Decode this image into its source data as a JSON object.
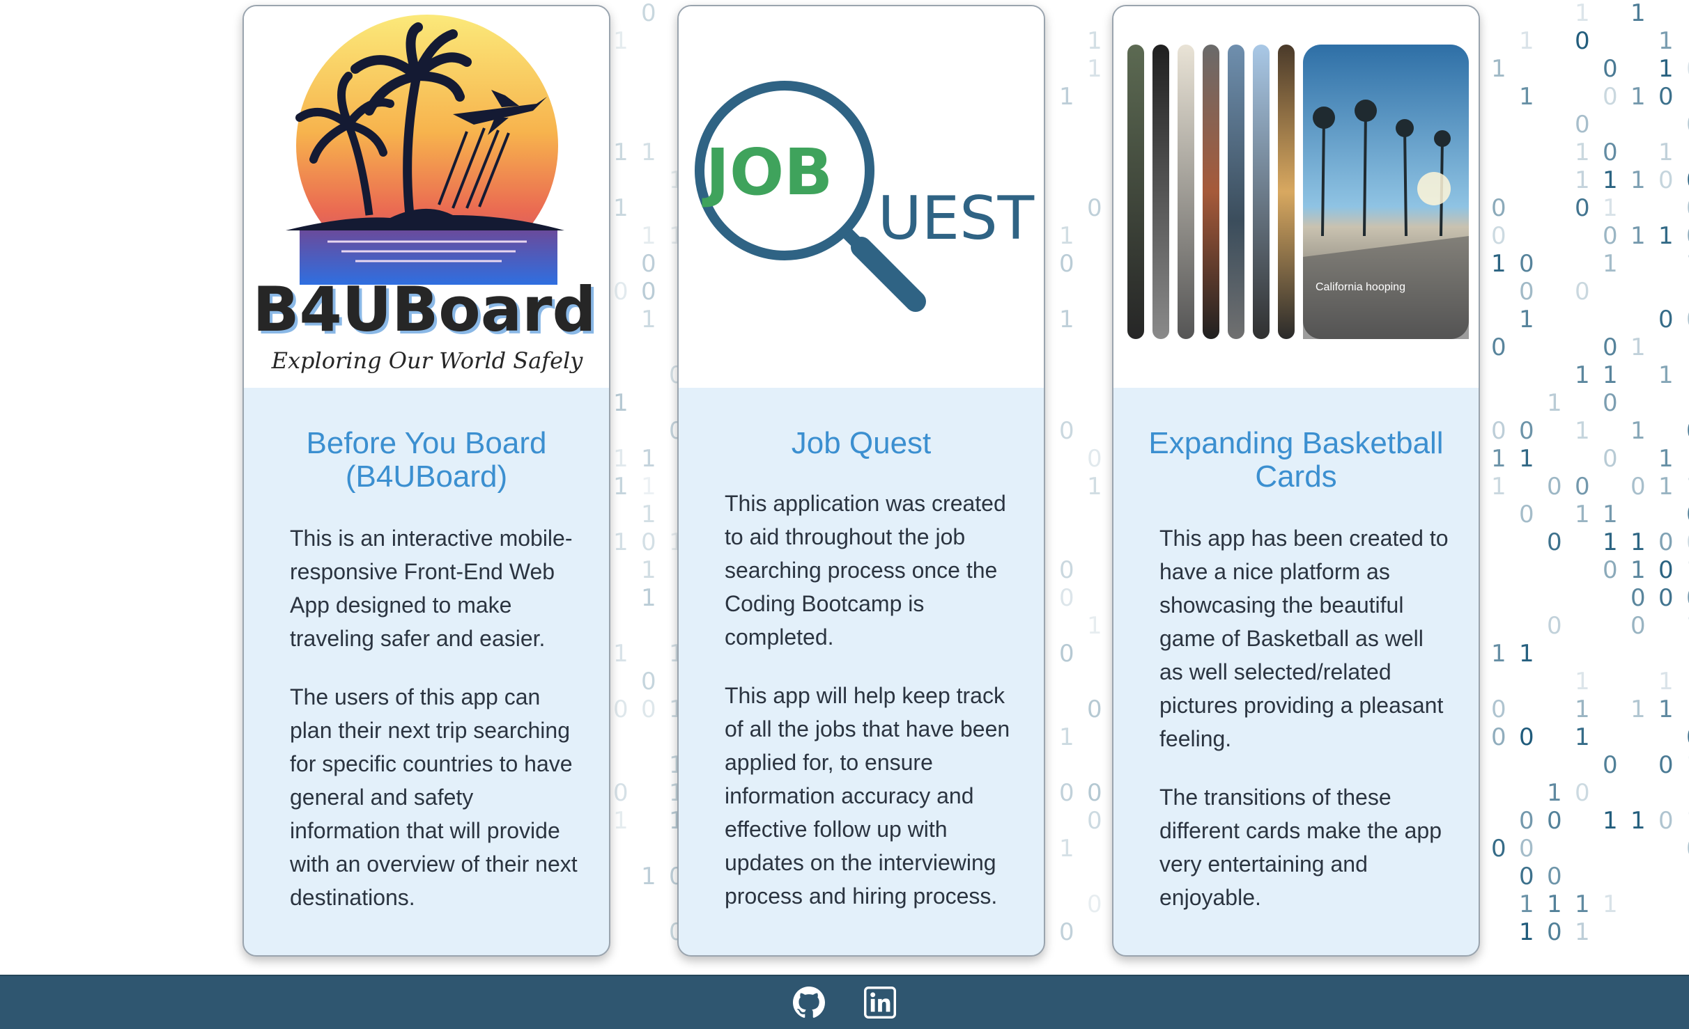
{
  "cards": [
    {
      "logo": {
        "title": "B4UBoard",
        "tagline": "Exploring Our World Safely"
      },
      "title": "Before You Board (B4UBoard)",
      "paragraphs": [
        "This is an interactive mobile-responsive Front-End Web App designed to make traveling safer and easier.",
        "The users of this app can plan their next trip searching for specific countries to have general and safety information that will provide with an overview of their next destinations."
      ]
    },
    {
      "logo": {
        "word1": "JOB",
        "word2": "UEST"
      },
      "title": "Job Quest",
      "paragraphs": [
        "This application was created to aid throughout the job searching process once the Coding Bootcamp is completed.",
        "This app will help keep track of all the jobs that have been applied for, to ensure information accuracy and effective follow up with updates on the interviewing process and hiring process."
      ]
    },
    {
      "image_caption": "California hooping",
      "title": "Expanding Basketball Cards",
      "paragraphs": [
        "This app has been created to have a nice platform as showcasing the beautiful game of Basketball as well as well selected/related pictures providing a pleasant feeling.",
        "The transitions of these different cards make the app very entertaining and enjoyable."
      ]
    }
  ],
  "footer": {
    "icons": [
      "github-icon",
      "linkedin-icon"
    ]
  },
  "colors": {
    "card_title": "#3b8fd0",
    "card_body_bg": "#e3f0fa",
    "footer_bg": "#2f5670",
    "binary_digits": "#1e5a7a"
  }
}
